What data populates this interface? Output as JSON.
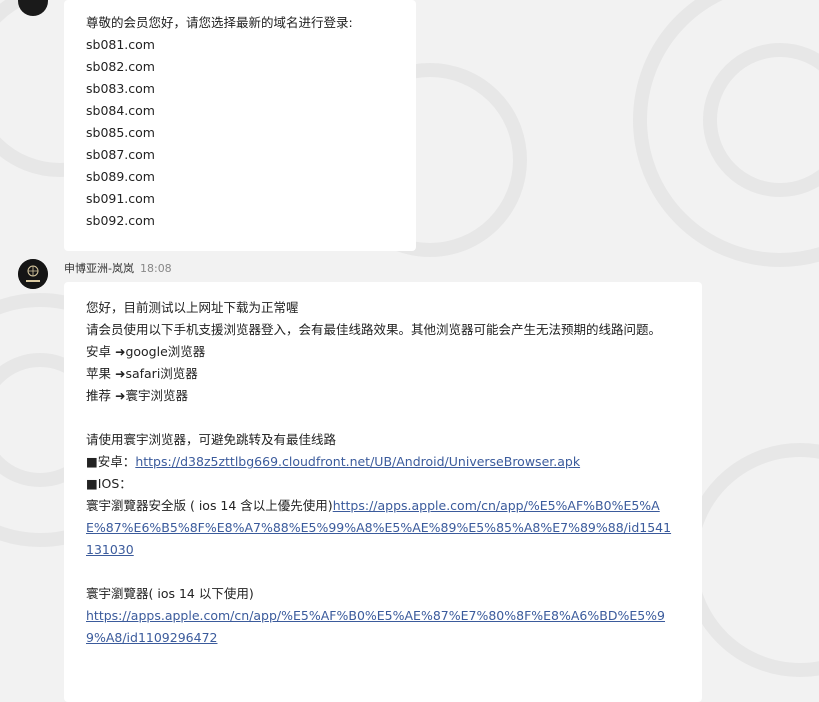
{
  "message1": {
    "greeting": "尊敬的会员您好，请您选择最新的域名进行登录:",
    "domains": [
      "sb081.com",
      "sb082.com",
      "sb083.com",
      "sb084.com",
      "sb085.com",
      "sb087.com",
      "sb089.com",
      "sb091.com",
      "sb092.com"
    ]
  },
  "message2": {
    "sender": "申博亚洲-岚岚",
    "time": "18:08",
    "line1": "您好，目前测试以上网址下载为正常喔",
    "line2": "请会员使用以下手机支援浏览器登入，会有最佳线路效果。其他浏览器可能会产生无法预期的线路问题。",
    "line3": "安卓 ➜google浏览器",
    "line4": "苹果 ➜safari浏览器",
    "line5": "推荐 ➜寰宇浏览器",
    "line6": "请使用寰宇浏览器，可避免跳转及有最佳线路",
    "android_label": "■安卓：",
    "android_link": "https://d38z5zttlbg669.cloudfront.net/UB/Android/UniverseBrowser.apk",
    "ios_label": "■IOS：",
    "ios_safe_label": "寰宇瀏覽器安全版 ( ios 14 含以上優先使用)",
    "ios_safe_link": "https://apps.apple.com/cn/app/%E5%AF%B0%E5%AE%87%E6%B5%8F%E8%A7%88%E5%99%A8%E5%AE%89%E5%85%A8%E7%89%88/id1541131030",
    "ios_old_label": "寰宇瀏覽器( ios 14 以下使用)",
    "ios_old_link": "https://apps.apple.com/cn/app/%E5%AF%B0%E5%AE%87%E7%80%8F%E8%A6%BD%E5%99%A8/id1109296472"
  },
  "colors": {
    "background": "#f2f2f2",
    "bubble": "#ffffff",
    "link": "#3b5b9c"
  },
  "icons": {
    "avatar": "avatar-logo-icon"
  }
}
